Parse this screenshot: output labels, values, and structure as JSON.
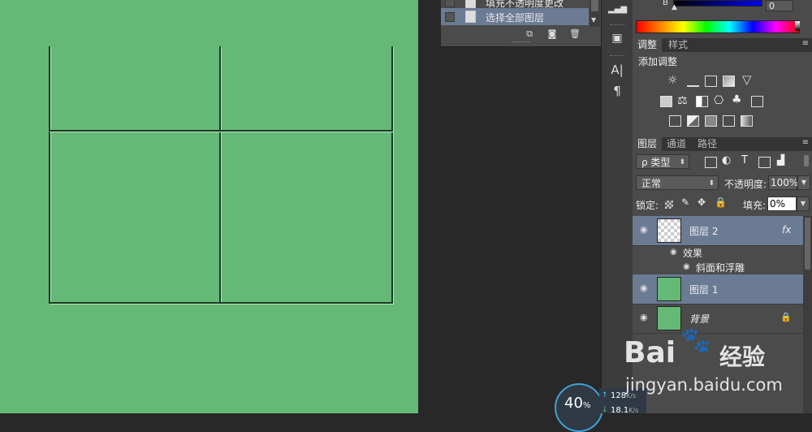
{
  "history": {
    "items": [
      {
        "label": "填充不透明度更改",
        "selected": false
      },
      {
        "label": "选择全部图层",
        "selected": true
      }
    ]
  },
  "colors": {
    "canvas_green": "#64b977",
    "layer_selected": "#6b7b94",
    "panel_bg": "#4b4b4b"
  },
  "color_panel": {
    "channel_label": "B",
    "channel_value": "0"
  },
  "adjust_panel": {
    "tabs": [
      "调整",
      "样式"
    ],
    "title": "添加调整"
  },
  "layers_panel": {
    "tabs": [
      "图层",
      "通道",
      "路径"
    ],
    "filter_kind": "ρ 类型",
    "blend_mode": "正常",
    "opacity_label": "不透明度:",
    "opacity_value": "100%",
    "lock_label": "锁定:",
    "fill_label": "填充:",
    "fill_value": "0%",
    "layers": [
      {
        "name": "图层 2",
        "fx": "fx",
        "selected": true
      },
      {
        "name": "图层 1",
        "selected": true
      },
      {
        "name": "背景",
        "locked": true
      }
    ],
    "effects_label": "效果",
    "effect_item": "斜面和浮雕"
  },
  "network": {
    "percent": "40",
    "percent_unit": "%",
    "upload": "128",
    "download": "18.1",
    "unit": "K/s"
  },
  "watermark": {
    "brand": "Bai",
    "brand2": "经验",
    "url": "jingyan.baidu.com"
  }
}
